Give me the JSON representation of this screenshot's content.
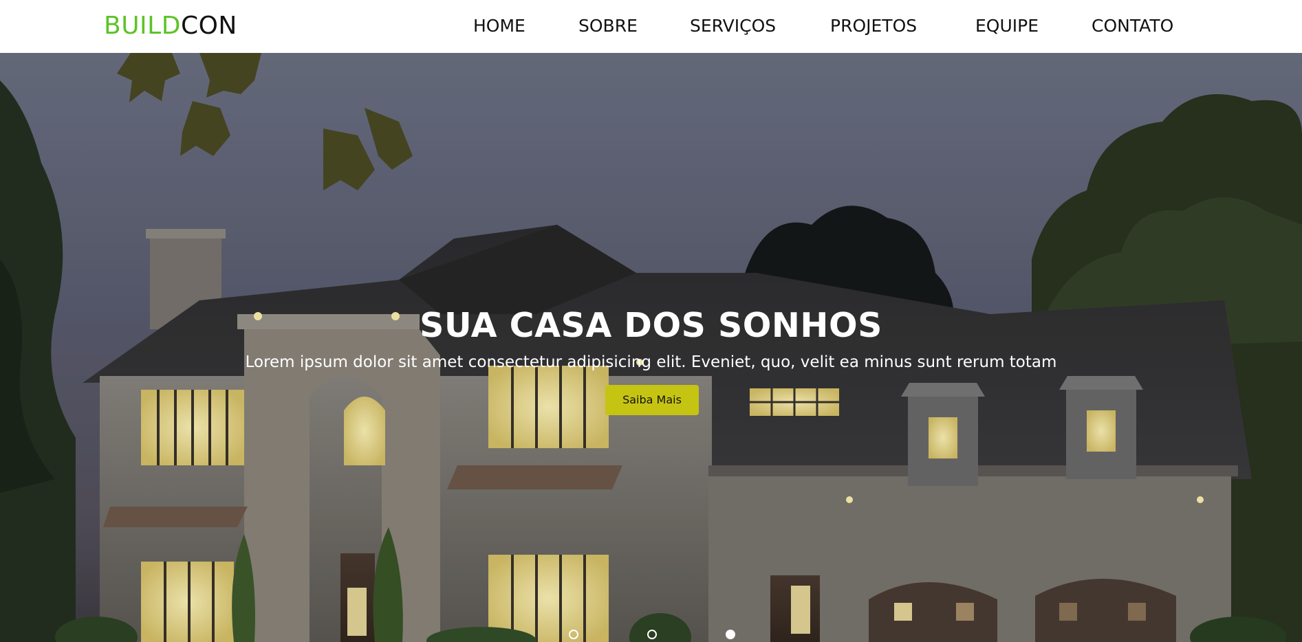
{
  "header": {
    "logo_accent": "BUILD",
    "logo_rest": "CON",
    "nav": [
      {
        "label": "HOME"
      },
      {
        "label": "SOBRE"
      },
      {
        "label": "SERVIÇOS"
      },
      {
        "label": "PROJETOS"
      },
      {
        "label": "EQUIPE"
      },
      {
        "label": "CONTATO"
      }
    ]
  },
  "hero": {
    "title": "SUA CASA DOS SONHOS",
    "subtitle": "Lorem ipsum dolor sit amet consectetur adipisicing elit. Eveniet, quo, velit ea minus sunt rerum totam",
    "button_label": "Saiba Mais",
    "slides_count": 3,
    "active_slide": 3
  },
  "colors": {
    "logo_accent": "#5cc426",
    "button_bg": "#c6c413",
    "header_bg": "#ffffff"
  }
}
